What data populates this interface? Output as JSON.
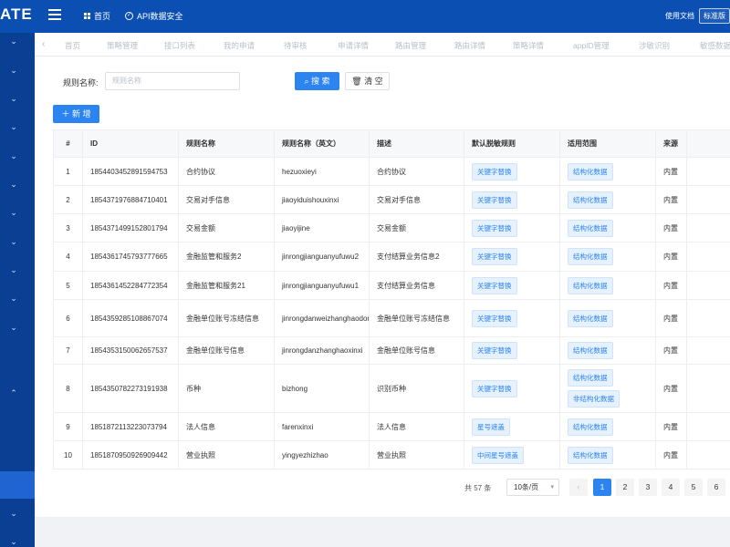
{
  "header": {
    "brand": "ATE",
    "nav_home": "首页",
    "nav_api": "API数据安全",
    "doc_link": "使用文档",
    "edition": "标准版"
  },
  "sidebar": {
    "icons": [
      "chevron-down-icon",
      "chevron-down-icon",
      "chevron-down-icon",
      "chevron-down-icon",
      "chevron-down-icon",
      "chevron-down-icon",
      "chevron-down-icon",
      "chevron-down-icon",
      "chevron-down-icon",
      "chevron-down-icon",
      "chevron-down-icon",
      "chevron-up-icon",
      "chevron-down-icon",
      "chevron-down-icon"
    ]
  },
  "tabs": [
    "首页",
    "策略管理",
    "接口列表",
    "我的申请",
    "待审核",
    "申请详情",
    "路由管理",
    "路由详情",
    "策略详情",
    "appID管理",
    "涉敏识别",
    "敏感数据"
  ],
  "filter": {
    "rule_name_label": "规则名称:",
    "rule_name_placeholder": "规则名称",
    "search_label": "搜 索",
    "clear_label": "清 空"
  },
  "toolbar": {
    "add_label": "新 增"
  },
  "table": {
    "columns": [
      "#",
      "ID",
      "规则名称",
      "规则名称（英文）",
      "描述",
      "默认脱敏规则",
      "适用范围",
      "来源"
    ],
    "rows": [
      {
        "no": "1",
        "id": "1854403452891594753",
        "name": "合约协议",
        "name_en": "hezuoxieyi",
        "desc": "合约协议",
        "rule": "关键字替换",
        "scope": [
          "结构化数据"
        ],
        "source": "内置"
      },
      {
        "no": "2",
        "id": "1854371976884710401",
        "name": "交易对手信息",
        "name_en": "jiaoyiduishouxinxi",
        "desc": "交易对手信息",
        "rule": "关键字替换",
        "scope": [
          "结构化数据"
        ],
        "source": "内置"
      },
      {
        "no": "3",
        "id": "1854371499152801794",
        "name": "交易金额",
        "name_en": "jiaoyijine",
        "desc": "交易金额",
        "rule": "关键字替换",
        "scope": [
          "结构化数据"
        ],
        "source": "内置"
      },
      {
        "no": "4",
        "id": "1854361745793777665",
        "name": "金融监管和服务2",
        "name_en": "jinrongjianguanyufuwu2",
        "desc": "支付结算业务信息2",
        "rule": "关键字替换",
        "scope": [
          "结构化数据"
        ],
        "source": "内置"
      },
      {
        "no": "5",
        "id": "1854361452284772354",
        "name": "金融监管和服务21",
        "name_en": "jinrongjianguanyufuwu1",
        "desc": "支付结算业务信息",
        "rule": "关键字替换",
        "scope": [
          "结构化数据"
        ],
        "source": "内置"
      },
      {
        "no": "6",
        "id": "1854359285108867074",
        "name": "金融单位账号冻结信息",
        "name_en": "jinrongdanweizhanghaodongjiexinxi",
        "desc": "金融单位账号冻结信息",
        "rule": "关键字替换",
        "scope": [
          "结构化数据"
        ],
        "source": "内置"
      },
      {
        "no": "7",
        "id": "1854353150062657537",
        "name": "金融单位账号信息",
        "name_en": "jinrongdanzhanghaoxinxi",
        "desc": "金融单位账号信息",
        "rule": "关键字替换",
        "scope": [
          "结构化数据"
        ],
        "source": "内置"
      },
      {
        "no": "8",
        "id": "1854350782273191938",
        "name": "币种",
        "name_en": "bizhong",
        "desc": "识别币种",
        "rule": "关键字替换",
        "scope": [
          "结构化数据",
          "非结构化数据"
        ],
        "source": "内置"
      },
      {
        "no": "9",
        "id": "1851872113223073794",
        "name": "法人信息",
        "name_en": "farenxinxi",
        "desc": "法人信息",
        "rule": "星号遮盖",
        "scope": [
          "结构化数据"
        ],
        "source": "内置"
      },
      {
        "no": "10",
        "id": "1851870950926909442",
        "name": "营业执照",
        "name_en": "yingyezhizhao",
        "desc": "营业执照",
        "rule": "中间星号遮盖",
        "scope": [
          "结构化数据"
        ],
        "source": "内置"
      }
    ]
  },
  "pagination": {
    "total": "共 57 条",
    "page_size": "10条/页",
    "pages": [
      "1",
      "2",
      "3",
      "4",
      "5",
      "6"
    ],
    "current": "1"
  },
  "colors": {
    "header": "#0b4fb3",
    "sidebar": "#0a3f94",
    "primary": "#2b84f0"
  }
}
